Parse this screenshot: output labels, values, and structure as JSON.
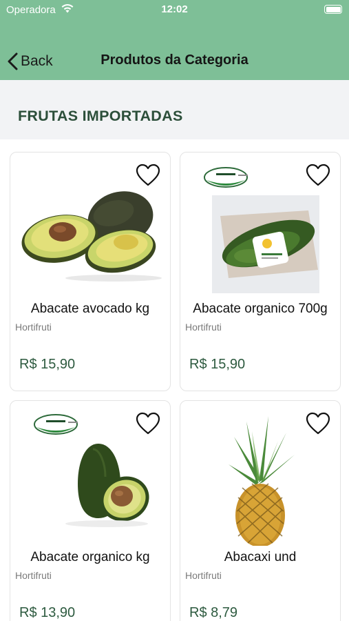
{
  "status_bar": {
    "carrier": "Operadora",
    "time": "12:02"
  },
  "nav": {
    "back_label": "Back",
    "title": "Produtos da Categoria"
  },
  "section": {
    "title": "FRUTAS IMPORTADAS"
  },
  "colors": {
    "header": "#7ebf97",
    "accent": "#2d5a3f",
    "section_text": "#2c4f3a"
  },
  "products": [
    {
      "name": "Abacate avocado kg",
      "category": "Hortifruti",
      "price": "R$ 15,90",
      "icon": "heart-outline-icon"
    },
    {
      "name": "Abacate organico 700g",
      "category": "Hortifruti",
      "price": "R$ 15,90",
      "icon": "heart-outline-icon"
    },
    {
      "name": "Abacate organico kg",
      "category": "Hortifruti",
      "price": "R$ 13,90",
      "icon": "heart-outline-icon"
    },
    {
      "name": "Abacaxi und",
      "category": "Hortifruti",
      "price": "R$ 8,79",
      "icon": "heart-outline-icon"
    }
  ]
}
